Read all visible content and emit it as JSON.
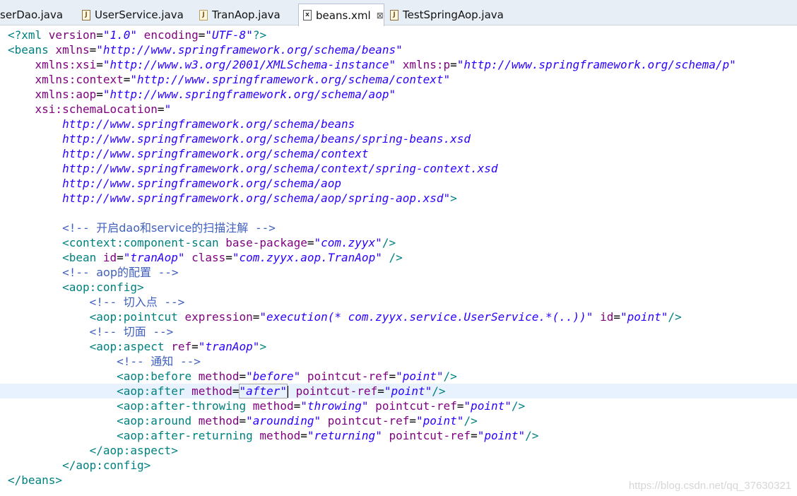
{
  "tabs": [
    {
      "label": "serDao.java",
      "icon": "java-file-icon"
    },
    {
      "label": "UserService.java",
      "icon": "java-file-icon"
    },
    {
      "label": "TranAop.java",
      "icon": "java-file-icon"
    },
    {
      "label": "beans.xml",
      "icon": "xml-file-icon",
      "active": true
    },
    {
      "label": "TestSpringAop.java",
      "icon": "java-file-icon"
    }
  ],
  "close_glyph": "⊠",
  "code": {
    "l1": {
      "open": "<?xml ",
      "a1": "version",
      "v1": "\"1.0\"",
      "a2": " encoding",
      "v2": "\"UTF-8\"",
      "close": "?>"
    },
    "l2": {
      "open": "<beans ",
      "a1": "xmlns",
      "v1": "\"http://www.springframework.org/schema/beans\""
    },
    "l3": {
      "a1": "xmlns:xsi",
      "v1": "\"http://www.w3.org/2001/XMLSchema-instance\"",
      "a2": " xmlns:p",
      "v2": "\"http://www.springframework.org/schema/p\""
    },
    "l4": {
      "a1": "xmlns:context",
      "v1": "\"http://www.springframework.org/schema/context\""
    },
    "l5": {
      "a1": "xmlns:aop",
      "v1": "\"http://www.springframework.org/schema/aop\""
    },
    "l6": {
      "a1": "xsi:schemaLocation",
      "v1": "\""
    },
    "l7": "http://www.springframework.org/schema/beans",
    "l8": "http://www.springframework.org/schema/beans/spring-beans.xsd",
    "l9": "http://www.springframework.org/schema/context",
    "l10": "http://www.springframework.org/schema/context/spring-context.xsd",
    "l11": "http://www.springframework.org/schema/aop",
    "l12": {
      "v": "http://www.springframework.org/schema/aop/spring-aop.xsd\"",
      "close": ">"
    },
    "l14": {
      "c1": "<!-- ",
      "txt": "开启dao和service的扫描注解",
      "c2": " -->"
    },
    "l15": {
      "open": "<context:component-scan ",
      "a1": "base-package",
      "v1": "\"com.zyyx\"",
      "close": "/>"
    },
    "l16": {
      "open": "<bean ",
      "a1": "id",
      "v1": "\"tranAop\"",
      "a2": " class",
      "v2": "\"com.zyyx.aop.TranAop\"",
      "close": " />"
    },
    "l17": {
      "c1": "<!-- ",
      "txt": "aop的配置",
      "c2": " -->"
    },
    "l18": {
      "open": "<aop:config>"
    },
    "l19": {
      "c1": "<!-- ",
      "txt": "切入点",
      "c2": " -->"
    },
    "l20": {
      "open": "<aop:pointcut ",
      "a1": "expression",
      "v1": "\"execution(* com.zyyx.service.UserService.*(..))\"",
      "a2": " id",
      "v2": "\"point\"",
      "close": "/>"
    },
    "l21": {
      "c1": "<!-- ",
      "txt": "切面",
      "c2": " -->"
    },
    "l22": {
      "open": "<aop:aspect ",
      "a1": "ref",
      "v1": "\"tranAop\"",
      "close": ">"
    },
    "l23": {
      "c1": "<!-- ",
      "txt": "通知",
      "c2": " -->"
    },
    "l24": {
      "open": "<aop:before ",
      "a1": "method",
      "v1": "\"before\"",
      "a2": " pointcut-ref",
      "v2": "\"point\"",
      "close": "/>"
    },
    "l25": {
      "open": "<aop:after ",
      "a1": "method",
      "v1a": "\"after\"",
      "a2": " pointcut-ref",
      "v2": "\"point\"",
      "close": "/>"
    },
    "l26": {
      "open": "<aop:after-throwing ",
      "a1": "method",
      "v1": "\"throwing\"",
      "a2": " pointcut-ref",
      "v2": "\"point\"",
      "close": "/>"
    },
    "l27": {
      "open": "<aop:around ",
      "a1": "method",
      "v1": "\"arounding\"",
      "a2": " pointcut-ref",
      "v2": "\"point\"",
      "close": "/>"
    },
    "l28": {
      "open": "<aop:after-returning ",
      "a1": "method",
      "v1": "\"returning\"",
      "a2": " pointcut-ref",
      "v2": "\"point\"",
      "close": "/>"
    },
    "l29": {
      "open": "</aop:aspect>"
    },
    "l30": {
      "open": "</aop:config>"
    },
    "l31": {
      "open": "</beans>"
    }
  },
  "watermark": "https://blog.csdn.net/qq_37630321"
}
